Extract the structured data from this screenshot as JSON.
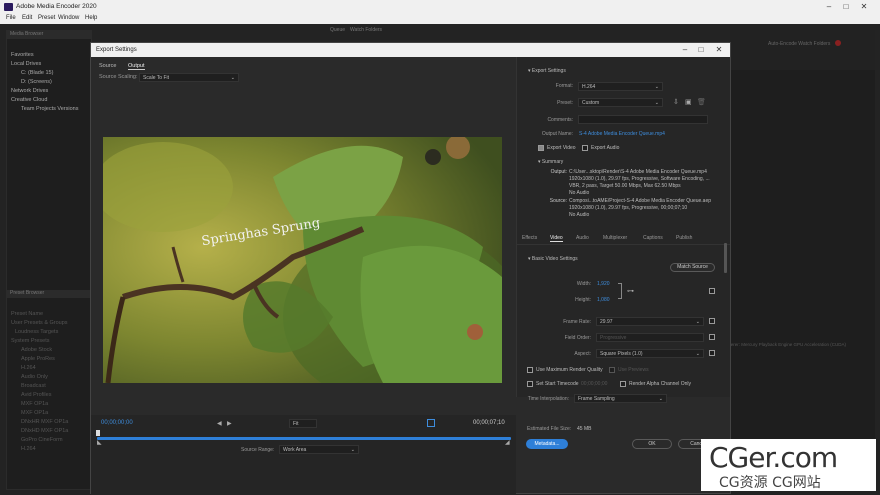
{
  "app": {
    "title": "Adobe Media Encoder 2020"
  },
  "menu": [
    "File",
    "Edit",
    "Preset",
    "Window",
    "Help"
  ],
  "left_panel": {
    "header": "Media Browser",
    "items": [
      "Favorites",
      "Local Drives",
      "C: (Blade 15)",
      "D: (Screens)",
      "Network Drives",
      "Creative Cloud",
      "Team Projects Versions"
    ],
    "lower_header": "Preset Browser",
    "lower_items": [
      "Preset Name",
      "User Presets & Groups",
      "Loudness Targets",
      "System Presets",
      "Adobe Stock",
      "Apple ProRes",
      "H.264",
      "Audio Only",
      "Broadcast",
      "Avid Profiles",
      "MXF OP1a",
      "MXF OP1a",
      "DNxHR MXF OP1a",
      "DNxHD MXF OP1a",
      "GoPro CineForm",
      "H.264"
    ]
  },
  "right_panel": {
    "queue_tabs": [
      "Queue",
      "Watch Folders"
    ],
    "auto_encode": "Auto-Encode Watch Folders",
    "renderer": "Renderer: Mercury Playback Engine GPU Acceleration (CUDA)"
  },
  "dialog": {
    "title": "Export Settings",
    "source_tab": "Source",
    "output_tab": "Output",
    "source_scaling_label": "Source Scaling:",
    "source_scaling_value": "Scale To Fit",
    "preview_caption": "Springhas Sprung",
    "timecode_in": "00;00;00;00",
    "timecode_out": "00;00;07;10",
    "fit_value": "Fit",
    "source_range_label": "Source Range:",
    "source_range_value": "Work Area",
    "export_settings": {
      "header": "Export Settings",
      "format_label": "Format:",
      "format_value": "H.264",
      "preset_label": "Preset:",
      "preset_value": "Custom",
      "comments_label": "Comments:",
      "output_name_label": "Output Name:",
      "output_name_value": "S-4 Adobe Media Encoder Queue.mp4",
      "export_video": "Export Video",
      "export_audio": "Export Audio",
      "export_video_checked": true,
      "export_audio_checked": false
    },
    "summary": {
      "header": "Summary",
      "output_label": "Output:",
      "output_lines": [
        "C:\\User...sktop\\Render\\S-4 Adobe Media Encoder Queue.mp4",
        "1920x1080 (1.0), 29.97 fps, Progressive, Software Encoding, ...",
        "VBR, 2 pass, Target 50.00 Mbps, Max 62.50 Mbps",
        "No Audio"
      ],
      "source_label": "Source:",
      "source_lines": [
        "Composi...toAME/Project-S-4 Adobe Media Encoder Queue.aep",
        "1920x1080 (1.0), 29.97 fps, Progressive, 00;00;07;10",
        "No Audio"
      ]
    },
    "setting_tabs": [
      "Effects",
      "Video",
      "Audio",
      "Multiplexer",
      "Captions",
      "Publish"
    ],
    "active_setting_tab": "Video",
    "basic_video": {
      "header": "Basic Video Settings",
      "match_source": "Match Source",
      "width_label": "Width:",
      "width_value": "1,920",
      "height_label": "Height:",
      "height_value": "1,080",
      "frame_rate_label": "Frame Rate:",
      "frame_rate_value": "29.97",
      "field_order_label": "Field Order:",
      "field_order_value": "Progressive",
      "aspect_label": "Aspect:",
      "aspect_value": "Square Pixels (1.0)"
    },
    "bottom_options": {
      "max_render_quality": "Use Maximum Render Quality",
      "use_previews": "Use Previews",
      "set_start_timecode": "Set Start Timecode",
      "start_timecode_value": "00;00;00;00",
      "render_alpha": "Render Alpha Channel Only",
      "time_interp_label": "Time Interpolation:",
      "time_interp_value": "Frame Sampling",
      "file_size_label": "Estimated File Size:",
      "file_size_value": "45 MB",
      "metadata_button": "Metadata...",
      "ok_button": "OK",
      "cancel_button": "Cancel"
    }
  },
  "watermark": {
    "main": "CGer.com",
    "sub": "CG资源 CG网站"
  },
  "colors": {
    "accent_blue": "#3e8ddd",
    "dialog_bg": "#2a2a2a",
    "app_bg": "#232323"
  }
}
